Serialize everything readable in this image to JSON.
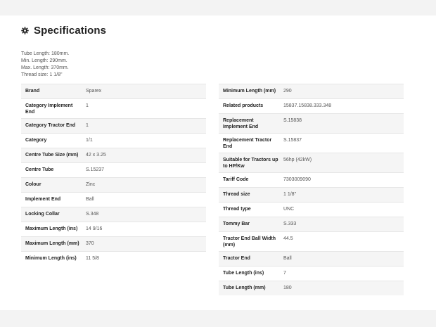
{
  "section": {
    "icon": "gear-icon",
    "title": "Specifications"
  },
  "summary": [
    "Tube Length: 180mm.",
    "Min. Length: 290mm.",
    "Max. Length: 370mm.",
    "Thread size: 1 1/8\""
  ],
  "left_table": [
    {
      "label": "Brand",
      "value": "Sparex"
    },
    {
      "label": "Category Implement End",
      "value": "1"
    },
    {
      "label": "Category Tractor End",
      "value": "1"
    },
    {
      "label": "Category",
      "value": "1/1"
    },
    {
      "label": "Centre Tube Size (mm)",
      "value": "42 x 3.25"
    },
    {
      "label": "Centre Tube",
      "value": "S.15237"
    },
    {
      "label": "Colour",
      "value": "Zinc"
    },
    {
      "label": "Implement End",
      "value": "Ball"
    },
    {
      "label": "Locking Collar",
      "value": "S.348"
    },
    {
      "label": "Maximum Length (ins)",
      "value": "14 9/16"
    },
    {
      "label": "Maximum Length (mm)",
      "value": "370"
    },
    {
      "label": "Minimum Length (ins)",
      "value": "11 5/8"
    }
  ],
  "right_table": [
    {
      "label": "Minimum Length (mm)",
      "value": "290"
    },
    {
      "label": "Related products",
      "value": "15837.15838.333.348"
    },
    {
      "label": "Replacement Implement End",
      "value": "S.15838"
    },
    {
      "label": "Replacement Tractor End",
      "value": "S.15837"
    },
    {
      "label": "Suitable for Tractors up to HP/Kw",
      "value": "56hp (42kW)"
    },
    {
      "label": "Tariff Code",
      "value": "7303009090"
    },
    {
      "label": "Thread size",
      "value": "1 1/8\""
    },
    {
      "label": "Thread type",
      "value": "UNC"
    },
    {
      "label": "Tommy Bar",
      "value": "S.333"
    },
    {
      "label": "Tractor End Ball Width (mm)",
      "value": "44.5"
    },
    {
      "label": "Tractor End",
      "value": "Ball"
    },
    {
      "label": "Tube Length (ins)",
      "value": "7"
    },
    {
      "label": "Tube Length (mm)",
      "value": "180"
    }
  ]
}
